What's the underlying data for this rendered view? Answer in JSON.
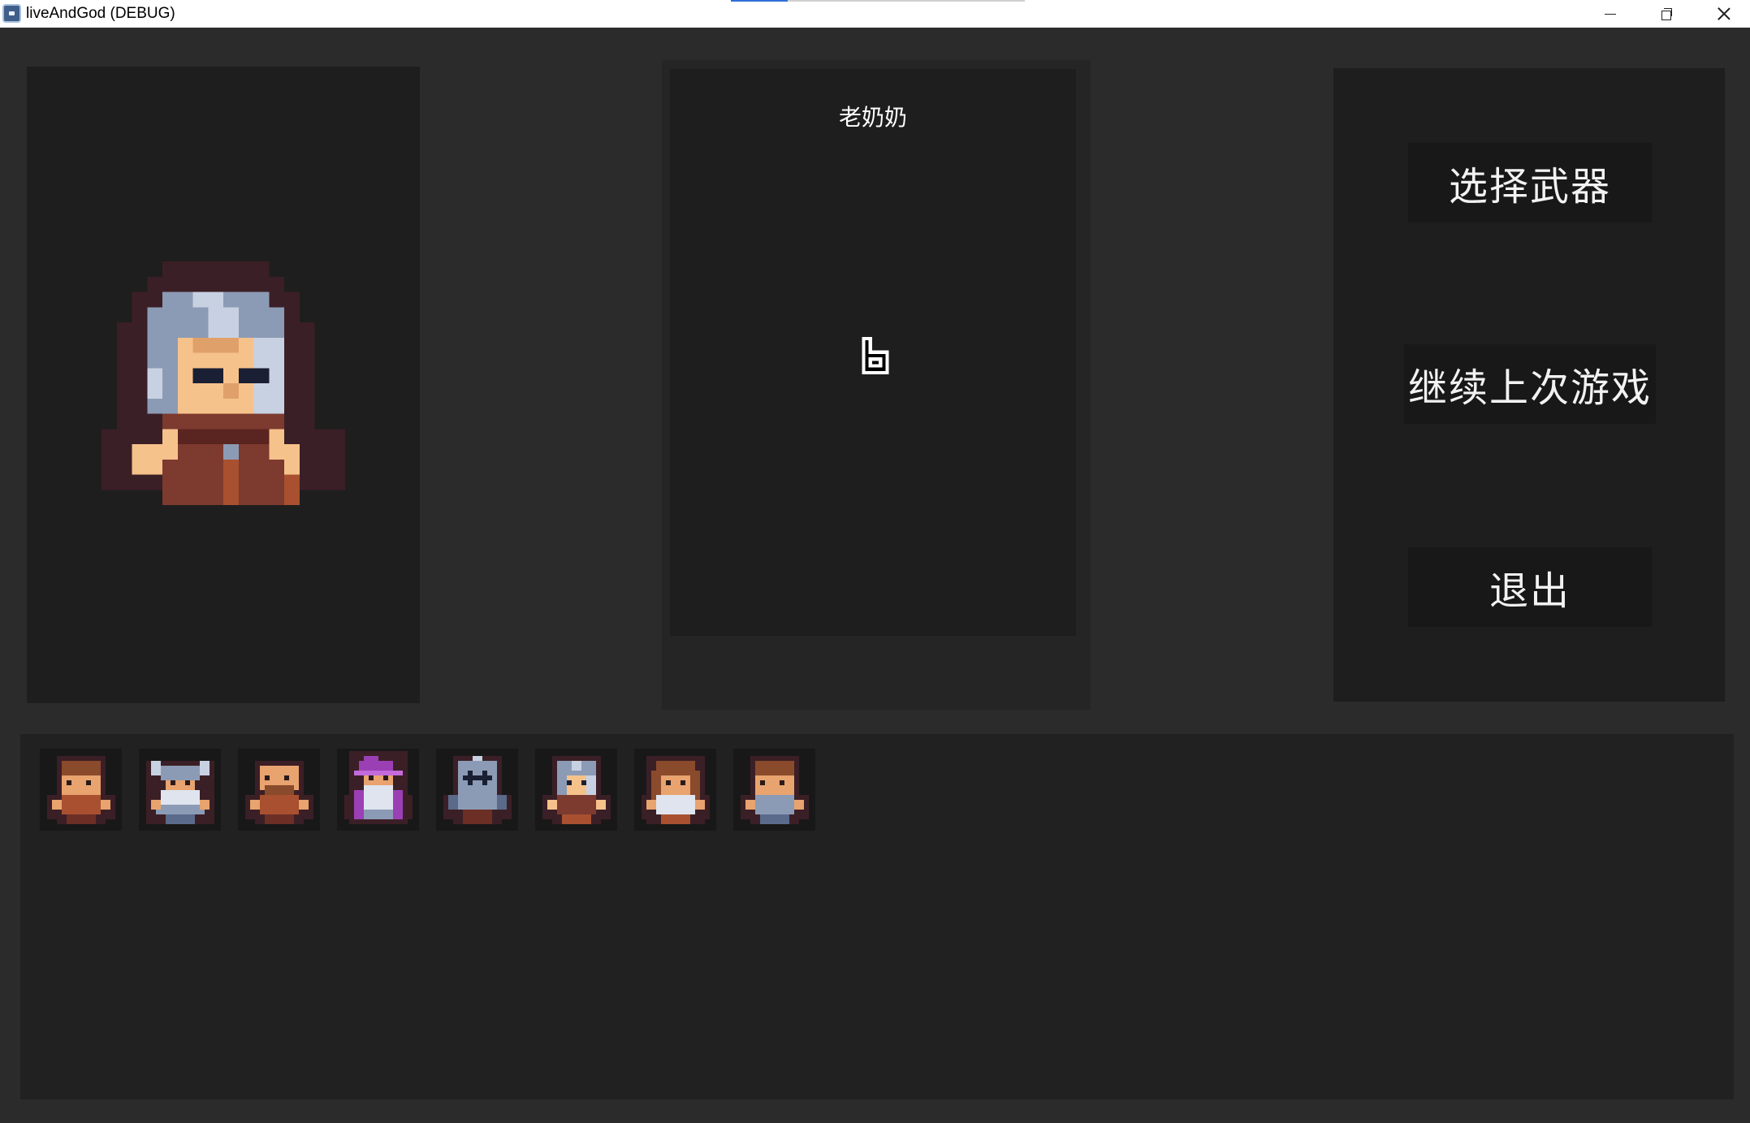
{
  "window": {
    "title": "liveAndGod (DEBUG)",
    "icon": "godot-engine-icon",
    "controls": [
      "minimize-icon",
      "restore-icon",
      "close-icon"
    ]
  },
  "selected_character": {
    "name": "老奶奶",
    "portrait": "old-grandma-portrait"
  },
  "menu": {
    "choose_weapon": "选择武器",
    "continue_game": "继续上次游戏",
    "exit": "退出"
  },
  "roster": [
    {
      "icon": "brown-hair-villager-icon"
    },
    {
      "icon": "horned-helmet-viking-icon"
    },
    {
      "icon": "bald-bearded-man-icon"
    },
    {
      "icon": "purple-wizard-icon"
    },
    {
      "icon": "armored-knight-icon"
    },
    {
      "icon": "grey-hair-grandma-icon"
    },
    {
      "icon": "brown-hair-girl-icon"
    },
    {
      "icon": "brown-hair-boy-icon"
    }
  ],
  "colors": {
    "background": "#2b2b2b",
    "panel": "#1e1e1e",
    "button": "#181818",
    "text": "#ffffff"
  }
}
